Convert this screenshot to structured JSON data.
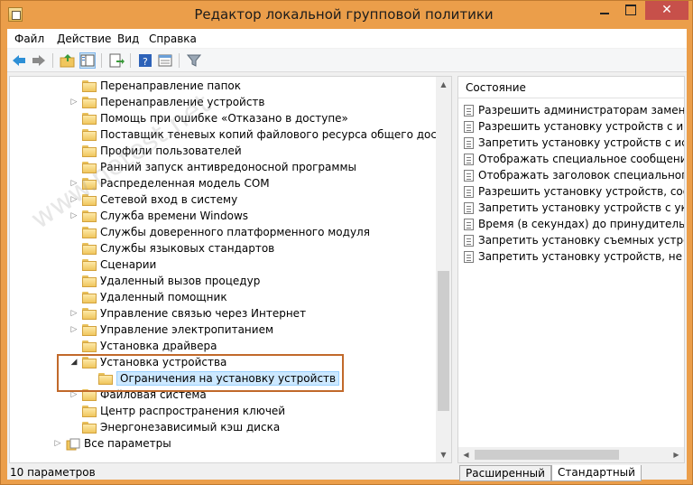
{
  "window": {
    "title": "Редактор локальной групповой политики",
    "close_glyph": "✕"
  },
  "menu": {
    "items": [
      "Файл",
      "Действие",
      "Вид",
      "Справка"
    ],
    "accelerators": [
      "Ф",
      "Д",
      "В",
      "С"
    ]
  },
  "toolbar": {
    "icons": [
      "back-icon",
      "forward-icon",
      "up-folder-icon",
      "show-hide-tree-icon",
      "export-list-icon",
      "help-icon",
      "properties-icon",
      "filter-icon"
    ]
  },
  "tree": {
    "items": [
      {
        "label": "Перенаправление папок",
        "expandable": false
      },
      {
        "label": "Перенаправление устройств",
        "expandable": true
      },
      {
        "label": "Помощь при ошибке «Отказано в доступе»",
        "expandable": false
      },
      {
        "label": "Поставщик теневых копий файлового ресурса общего доступа",
        "expandable": false
      },
      {
        "label": "Профили пользователей",
        "expandable": false
      },
      {
        "label": "Ранний запуск антивредоносной программы",
        "expandable": false
      },
      {
        "label": "Распределенная модель COM",
        "expandable": true
      },
      {
        "label": "Сетевой вход в систему",
        "expandable": true
      },
      {
        "label": "Служба времени Windows",
        "expandable": true
      },
      {
        "label": "Службы доверенного платформенного модуля",
        "expandable": false
      },
      {
        "label": "Службы языковых стандартов",
        "expandable": false
      },
      {
        "label": "Сценарии",
        "expandable": false
      },
      {
        "label": "Удаленный вызов процедур",
        "expandable": false
      },
      {
        "label": "Удаленный помощник",
        "expandable": false
      },
      {
        "label": "Управление связью через Интернет",
        "expandable": true
      },
      {
        "label": "Управление электропитанием",
        "expandable": true
      },
      {
        "label": "Установка драйвера",
        "expandable": false
      },
      {
        "label": "Установка устройства",
        "expandable": true,
        "expanded": true
      },
      {
        "label": "Ограничения на установку устройств",
        "expandable": false,
        "selected": true,
        "child": true
      },
      {
        "label": "Файловая система",
        "expandable": true
      },
      {
        "label": "Центр распространения ключей",
        "expandable": false
      },
      {
        "label": "Энергонезависимый кэш диска",
        "expandable": false
      },
      {
        "label": "Все параметры",
        "expandable": true,
        "root": true
      }
    ]
  },
  "settings": {
    "column_header": "Состояние",
    "items": [
      "Разрешить администраторам заменять п",
      "Разрешить установку устройств с исполь",
      "Запретить установку устройств с исполь",
      "Отображать специальное сообщение, ко",
      "Отображать заголовок специального со",
      "Разрешить установку устройств, соответ",
      "Запретить установку устройств с указанн",
      "Время (в секундах) до принудительной пе",
      "Запретить установку съемных устройств",
      "Запретить установку устройств, не описа"
    ]
  },
  "tabs": {
    "extended": "Расширенный",
    "standard": "Стандартный"
  },
  "status": {
    "text": "10 параметров"
  },
  "watermark": {
    "text": "www.netest.net"
  },
  "colors": {
    "titlebar": "#eb9e4a",
    "close_button": "#c7504a",
    "selection": "#cce8ff",
    "highlight_border": "#c1692a"
  }
}
